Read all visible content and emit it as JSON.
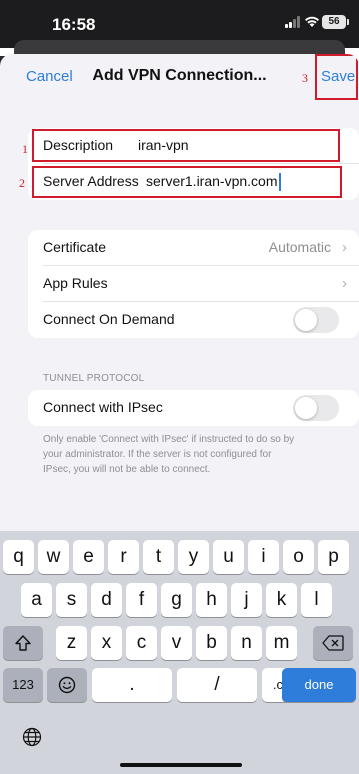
{
  "status_bar": {
    "time": "16:58",
    "battery": "56"
  },
  "nav": {
    "cancel": "Cancel",
    "title": "Add VPN Connection...",
    "save": "Save"
  },
  "annotations": {
    "one": "1",
    "two": "2",
    "three": "3"
  },
  "fields": {
    "description_label": "Description",
    "description_value": "iran-vpn",
    "server_label": "Server Address",
    "server_value": "server1.iran-vpn.com"
  },
  "settings": {
    "certificate_label": "Certificate",
    "certificate_value": "Automatic",
    "app_rules_label": "App Rules",
    "connect_on_demand_label": "Connect On Demand",
    "connect_on_demand_on": false
  },
  "tunnel": {
    "header": "TUNNEL PROTOCOL",
    "ipsec_label": "Connect with IPsec",
    "ipsec_on": false,
    "footnote_lines": [
      "Only enable 'Connect with IPsec' if instructed to do so by",
      "your administrator. If the server is not configured for",
      "IPsec, you will not be able to connect."
    ]
  },
  "keyboard": {
    "row1": [
      "q",
      "w",
      "e",
      "r",
      "t",
      "y",
      "u",
      "i",
      "o",
      "p"
    ],
    "row2": [
      "a",
      "s",
      "d",
      "f",
      "g",
      "h",
      "j",
      "k",
      "l"
    ],
    "row3": [
      "z",
      "x",
      "c",
      "v",
      "b",
      "n",
      "m"
    ],
    "numbers_key": "123",
    "period_key": ".",
    "slash_key": "/",
    "dotcom_key": ".com",
    "done_key": "done"
  },
  "colors": {
    "accent": "#2e7ddb",
    "annotation_red": "#cf1b2b",
    "background": "#f2f2f7"
  },
  "icons": [
    "signal-icon",
    "wifi-icon",
    "battery-icon",
    "chevron-right-icon",
    "shift-icon",
    "delete-icon",
    "emoji-icon",
    "globe-icon"
  ]
}
